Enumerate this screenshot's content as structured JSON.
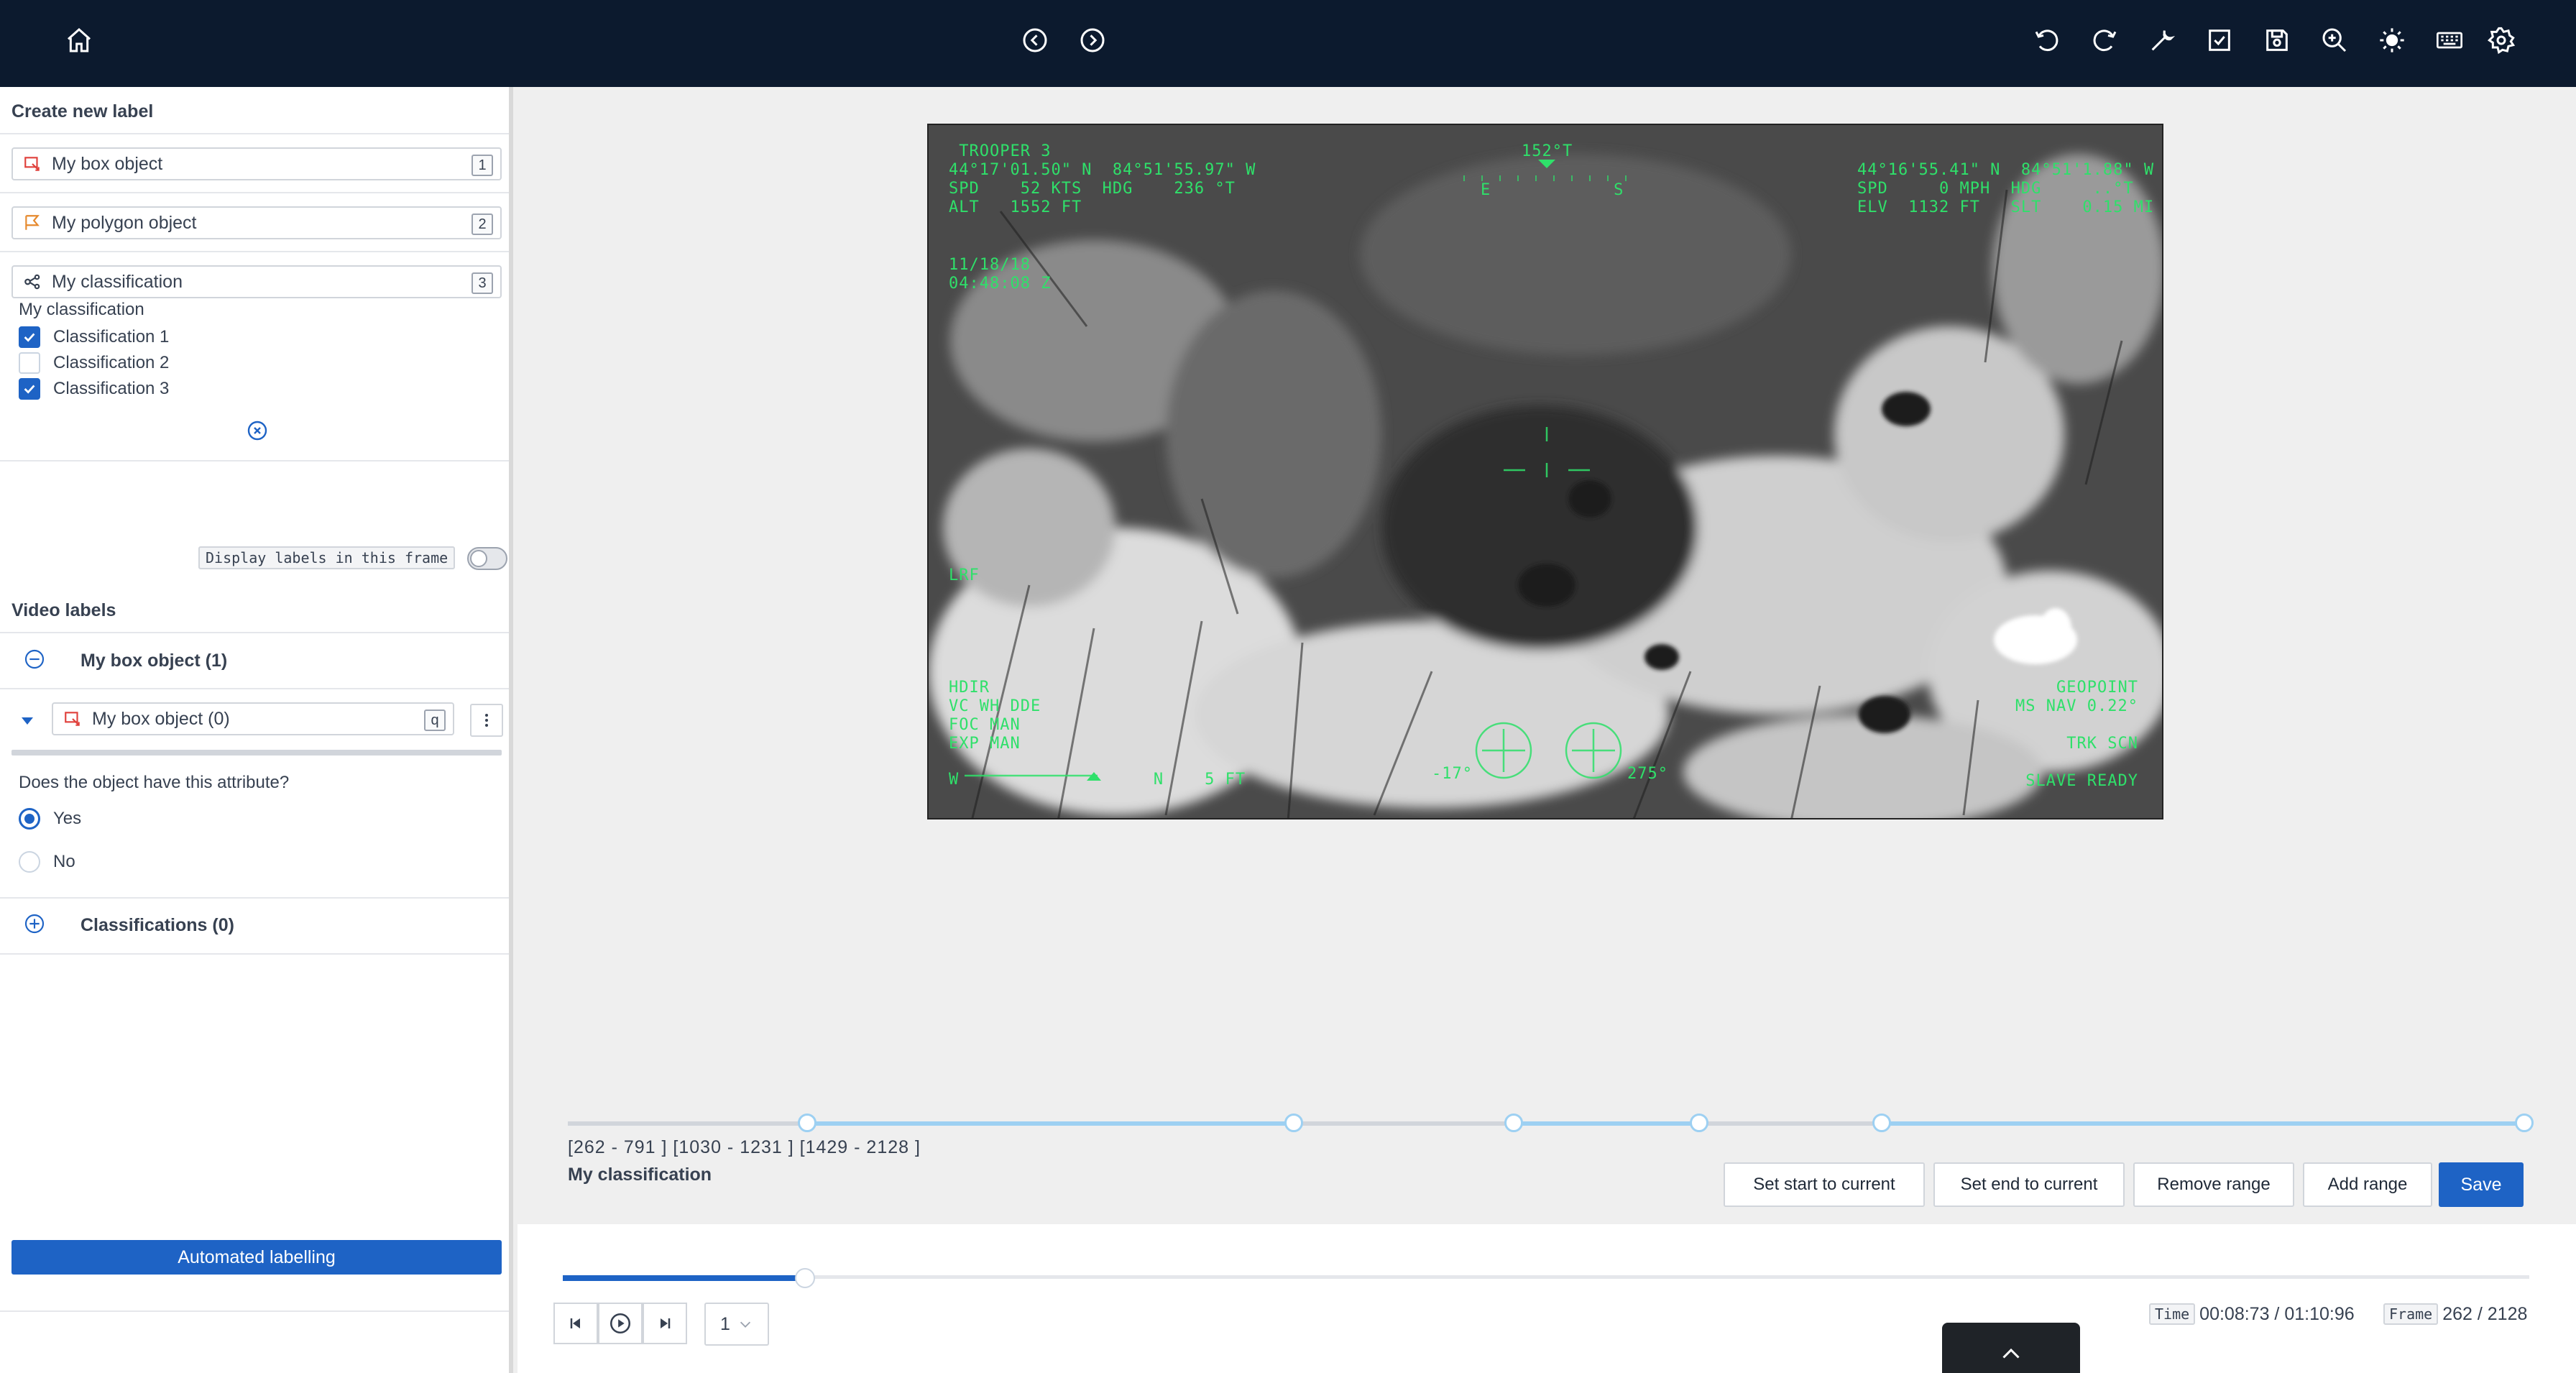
{
  "toolbar": {
    "icons": [
      "home-icon",
      "prev-icon",
      "next-icon",
      "undo-icon",
      "redo-icon",
      "wrench-icon",
      "checklist-icon",
      "save-icon",
      "zoom-icon",
      "brightness-icon",
      "keyboard-icon",
      "settings-icon"
    ]
  },
  "sidebar": {
    "create_title": "Create new label",
    "labels": [
      {
        "name": "My box object",
        "key": "1",
        "icon": "box-icon",
        "color": "#e0413c"
      },
      {
        "name": "My polygon object",
        "key": "2",
        "icon": "polygon-icon",
        "color": "#e68a2e"
      },
      {
        "name": "My classification",
        "key": "3",
        "icon": "classification-icon",
        "color": "#374151"
      }
    ],
    "classification": {
      "title": "My classification",
      "options": [
        {
          "label": "Classification 1",
          "checked": true
        },
        {
          "label": "Classification 2",
          "checked": false
        },
        {
          "label": "Classification 3",
          "checked": true
        }
      ]
    },
    "display_toggle_label": "Display labels in this frame",
    "video_labels_title": "Video labels",
    "group_box": "My box object (1)",
    "instance": {
      "name": "My box object (0)",
      "key": "q"
    },
    "attribute_question": "Does the object have this attribute?",
    "attribute_options": [
      {
        "label": "Yes",
        "selected": true
      },
      {
        "label": "No",
        "selected": false
      }
    ],
    "group_classifications": "Classifications (0)",
    "automated_button": "Automated labelling"
  },
  "video": {
    "hud_tl": " TROOPER 3\n44°17'01.50\" N  84°51'55.97\" W\nSPD    52 KTS  HDG    236 °T\nALT   1552 FT",
    "hud_tc": "152°T",
    "hud_compass": "E            S",
    "hud_tr": "44°16'55.41\" N  84°51'1.88\" W\nSPD     0 MPH  HDG     ..°T\nELV  1132 FT   SLT    0.15 MI",
    "hud_date": "11/18/18\n04:48:08 Z",
    "hud_lrf": "LRF",
    "hud_bl": "HDIR\nVC WH DDE\nFOC MAN\nEXP MAN",
    "hud_bottom_scale": "W                   N    5 FT",
    "hud_angle_left": "-17°",
    "hud_angle_right": "275°",
    "hud_br": "GEOPOINT\nMS NAV 0.22°\n\nTRK SCN\n\nSLAVE READY"
  },
  "timeline": {
    "ranges_text": "[262 - 791 ] [1030 - 1231 ] [1429 - 2128 ]",
    "classification_name": "My classification",
    "buttons": {
      "set_start": "Set start to current",
      "set_end": "Set end to current",
      "remove": "Remove range",
      "add": "Add range",
      "save": "Save"
    }
  },
  "player": {
    "progress": 0.123,
    "speed": "1",
    "time_tag": "Time",
    "time_value": "00:08:73 / 01:10:96",
    "frame_tag": "Frame",
    "frame_value": "262 / 2128"
  },
  "colors": {
    "accent": "#1e63c5",
    "topbar": "#0c1a2e",
    "hud": "#2fe06a",
    "range": "#9dd0f2"
  }
}
